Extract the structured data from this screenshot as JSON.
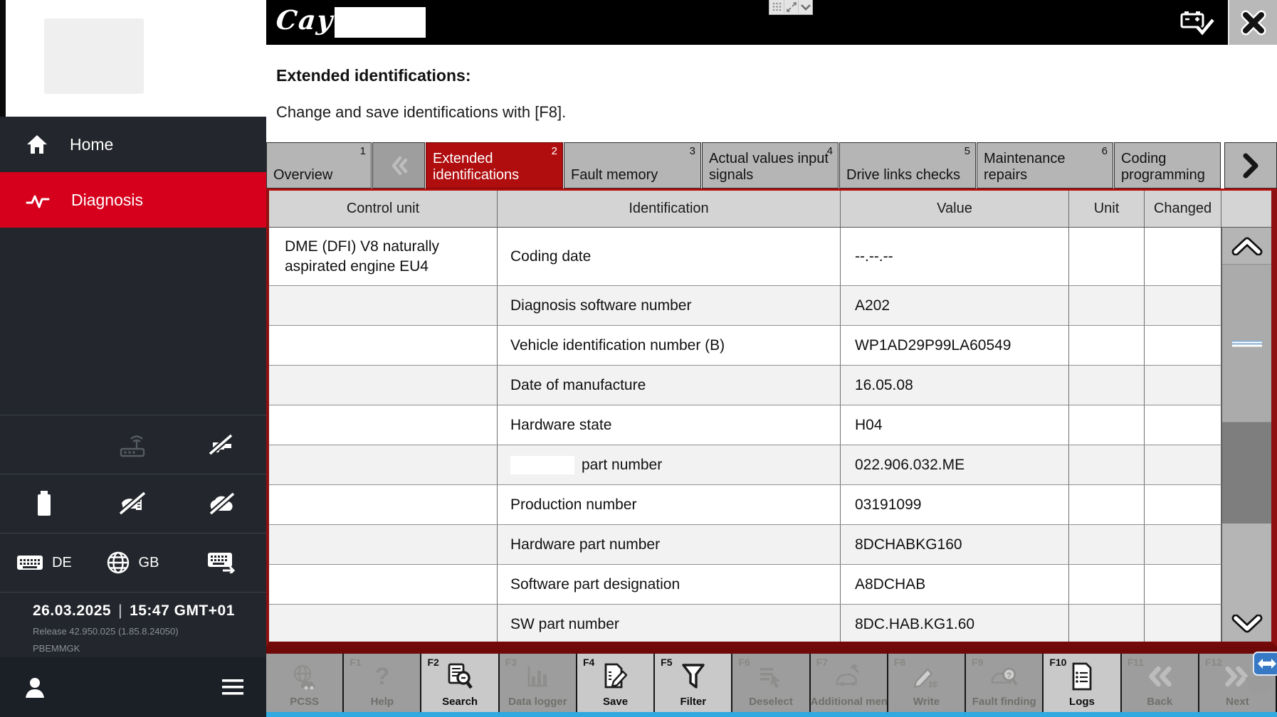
{
  "colors": {
    "accent_red": "#d6001c",
    "tab_active_red": "#b00d0f",
    "table_border_red": "#8f1010",
    "sidebar_bg": "#23262c",
    "session_border_blue": "#2fa9e0"
  },
  "topbar": {
    "brand_script": "Cay"
  },
  "page": {
    "title": "Extended identifications:",
    "subtitle": "Change and save identifications with [F8]."
  },
  "sidebar": {
    "items": [
      {
        "label": "Home"
      },
      {
        "label": "Diagnosis"
      }
    ],
    "keyboard_language": "DE",
    "display_language": "GB",
    "date": "26.03.2025",
    "separator": "|",
    "time": "15:47 GMT+01",
    "release": "Release 42.950.025 (1.85.8.24050)",
    "station": "PBEMMGK"
  },
  "tabs": [
    {
      "label": "Overview",
      "number": "1"
    },
    {
      "label": "Extended identifications",
      "number": "2",
      "active": true
    },
    {
      "label": "Fault memory",
      "number": "3"
    },
    {
      "label": "Actual values input signals",
      "number": "4"
    },
    {
      "label": "Drive links checks",
      "number": "5"
    },
    {
      "label": "Maintenance repairs",
      "number": "6"
    },
    {
      "label": "Coding programming",
      "number": ""
    }
  ],
  "table": {
    "columns": [
      "Control unit",
      "Identification",
      "Value",
      "Unit",
      "Changed"
    ],
    "rows": [
      {
        "control_unit": "DME (DFI) V8 naturally aspirated engine EU4",
        "identification": "Coding date",
        "value": "--.--.--",
        "unit": "",
        "changed": ""
      },
      {
        "control_unit": "",
        "identification": "Diagnosis software number",
        "value": "A202",
        "unit": "",
        "changed": ""
      },
      {
        "control_unit": "",
        "identification": "Vehicle identification number (B)",
        "value": "WP1AD29P99LA60549",
        "unit": "",
        "changed": ""
      },
      {
        "control_unit": "",
        "identification": "Date of manufacture",
        "value": "16.05.08",
        "unit": "",
        "changed": ""
      },
      {
        "control_unit": "",
        "identification": "Hardware state",
        "value": "H04",
        "unit": "",
        "changed": ""
      },
      {
        "control_unit": "",
        "identification": "part number",
        "redacted_prefix": true,
        "value": "022.906.032.ME",
        "unit": "",
        "changed": ""
      },
      {
        "control_unit": "",
        "identification": "Production number",
        "value": "03191099",
        "unit": "",
        "changed": ""
      },
      {
        "control_unit": "",
        "identification": "Hardware part number",
        "value": "8DCHABKG160",
        "unit": "",
        "changed": ""
      },
      {
        "control_unit": "",
        "identification": "Software part designation",
        "value": "A8DCHAB",
        "unit": "",
        "changed": ""
      },
      {
        "control_unit": "",
        "identification": "SW part number",
        "value": "8DC.HAB.KG1.60",
        "unit": "",
        "changed": ""
      }
    ]
  },
  "function_bar": [
    {
      "key": "",
      "label": "PCSS",
      "enabled": false,
      "icon": "globe-car"
    },
    {
      "key": "F1",
      "label": "Help",
      "enabled": false,
      "icon": "question-mark"
    },
    {
      "key": "F2",
      "label": "Search",
      "enabled": true,
      "icon": "search-document"
    },
    {
      "key": "F3",
      "label": "Data logger",
      "enabled": false,
      "icon": "bar-chart"
    },
    {
      "key": "F4",
      "label": "Save",
      "enabled": true,
      "icon": "save-document"
    },
    {
      "key": "F5",
      "label": "Filter",
      "enabled": true,
      "icon": "funnel"
    },
    {
      "key": "F6",
      "label": "Deselect",
      "enabled": false,
      "icon": "deselect-list"
    },
    {
      "key": "F7",
      "label": "Additional menu",
      "enabled": false,
      "icon": "car-tools"
    },
    {
      "key": "F8",
      "label": "Write",
      "enabled": false,
      "icon": "pencil-write"
    },
    {
      "key": "F9",
      "label": "Fault finding",
      "enabled": false,
      "icon": "car-magnifier"
    },
    {
      "key": "F10",
      "label": "Logs",
      "enabled": true,
      "icon": "log-document"
    },
    {
      "key": "F11",
      "label": "Back",
      "enabled": false,
      "icon": "chevrons-left"
    },
    {
      "key": "F12",
      "label": "Next",
      "enabled": false,
      "icon": "chevrons-right"
    }
  ]
}
